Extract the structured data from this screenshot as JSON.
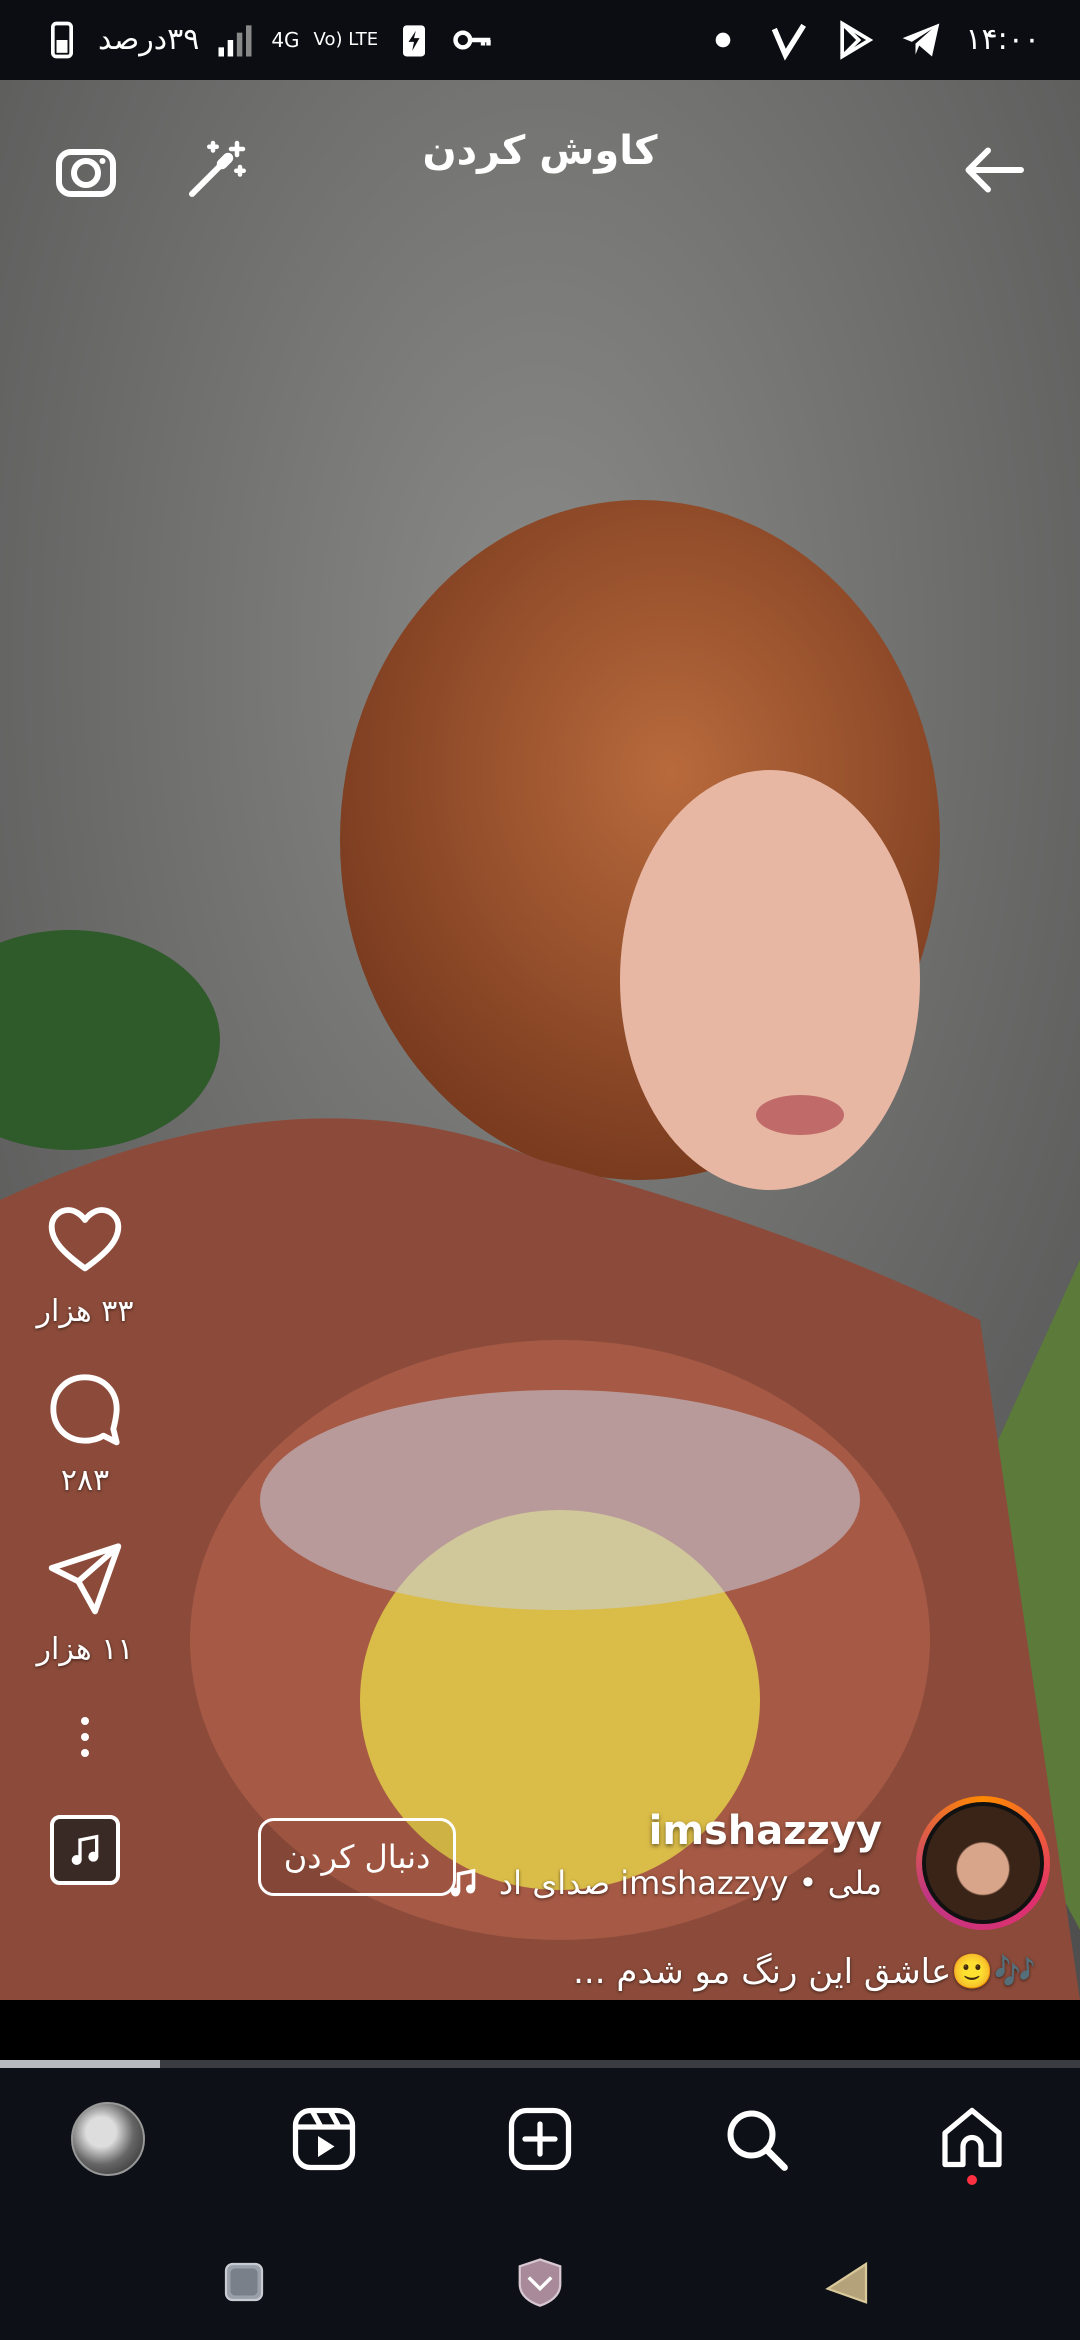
{
  "status_bar": {
    "time": "۱۴:۰۰",
    "battery_text": "۳۹درصد",
    "network_4g": "4G",
    "volte": "Vo) LTE"
  },
  "header": {
    "title": "کاوش کردن",
    "camera_icon": "camera-icon",
    "effects_icon": "magic-wand-icon",
    "back_icon": "arrow-left-icon"
  },
  "actions": {
    "likes": "۳۳ هزار",
    "comments": "۲۸۳",
    "shares": "۱۱ هزار"
  },
  "reel": {
    "username": "imshazzyy",
    "audio_text": "ملی • imshazzyy صدای اد",
    "follow_label": "دنبال کردن",
    "caption": "🎶🙂عاشق این رنگ مو شدم ..."
  },
  "progress": {
    "fraction": 0.148
  },
  "bottom_nav": [
    "profile-avatar",
    "reels-icon",
    "add-post-icon",
    "search-icon",
    "home-icon"
  ],
  "colors": {
    "background": "#0d1117",
    "accent_red": "#ff3040",
    "story_ring_start": "#ff8a00",
    "story_ring_end": "#c13584"
  }
}
